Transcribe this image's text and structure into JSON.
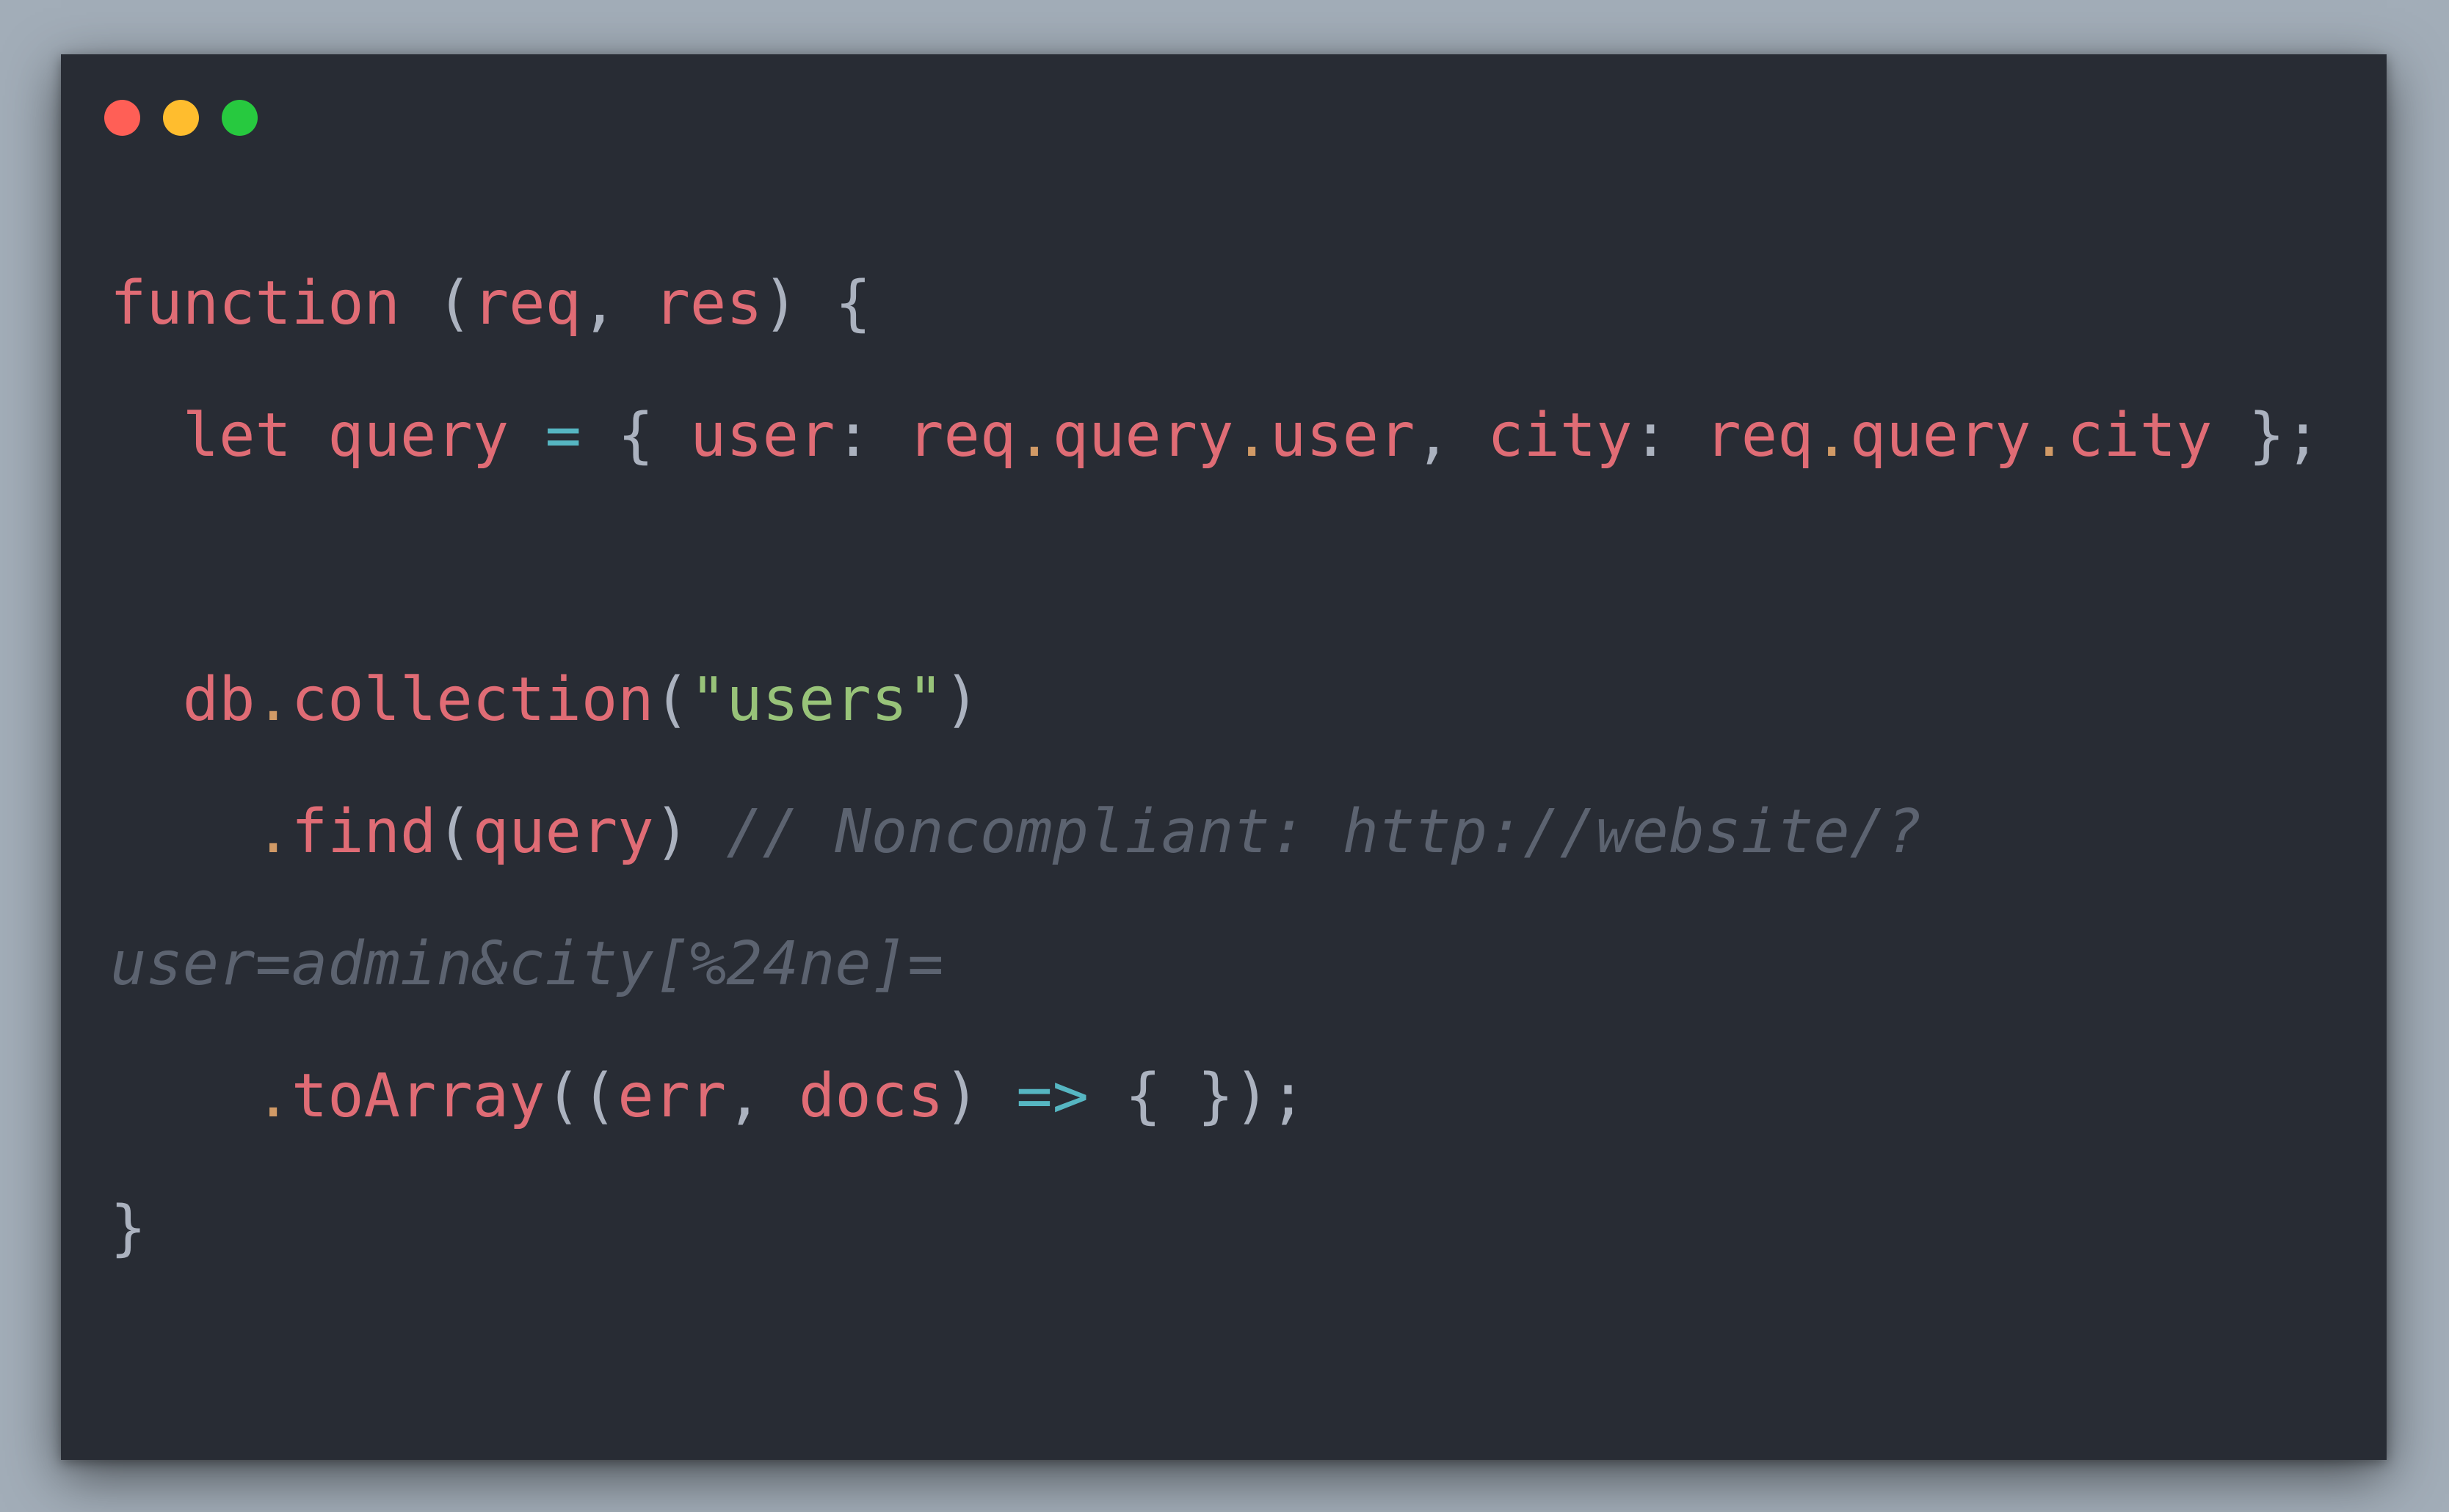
{
  "colors": {
    "background": "#a2adb8",
    "window": "#282c34",
    "close": "#ff5f56",
    "minimize": "#ffbd2e",
    "maximize": "#27c93f",
    "keyword": "#e06c75",
    "identifier": "#e06c75",
    "punctuation": "#abb2bf",
    "operator": "#56b6c2",
    "string": "#98c379",
    "dot": "#d19a66",
    "comment": "#5c6370"
  },
  "window_controls": [
    "close-dot",
    "minimize-dot",
    "maximize-dot"
  ],
  "code": {
    "l1": {
      "function": "function",
      "open_paren": " (",
      "req": "req",
      "comma": ", ",
      "res": "res",
      "close": ") {"
    },
    "l2": {
      "indent": "  ",
      "let": "let",
      "sp1": " ",
      "query": "query",
      "sp2": " ",
      "eq": "=",
      "open": " { ",
      "user_key": "user",
      "colon1": ": ",
      "req1": "req",
      "dot1": ".",
      "query1": "query",
      "dot2": ".",
      "user1": "user",
      "comma": ", ",
      "city_key": "city",
      "colon2": ": ",
      "req2": "req",
      "dot3": ".",
      "query2": "query",
      "dot4": ".",
      "city2": "city",
      "close": " };"
    },
    "l4": {
      "indent": "  ",
      "db": "db",
      "dot": ".",
      "collection": "collection",
      "open": "(",
      "string": "\"users\"",
      "close": ")"
    },
    "l5": {
      "indent": "    ",
      "dot": ".",
      "find": "find",
      "open": "(",
      "query": "query",
      "close": ") ",
      "comment": "// Noncompliant: http://website/?"
    },
    "l6": {
      "comment": "user=admin&city[%24ne]="
    },
    "l7": {
      "indent": "    ",
      "dot": ".",
      "toArray": "toArray",
      "open": "((",
      "err": "err",
      "comma": ", ",
      "docs": "docs",
      "close": ") ",
      "arrow": "=>",
      "body": " { });"
    },
    "l8": {
      "close": "}"
    }
  }
}
